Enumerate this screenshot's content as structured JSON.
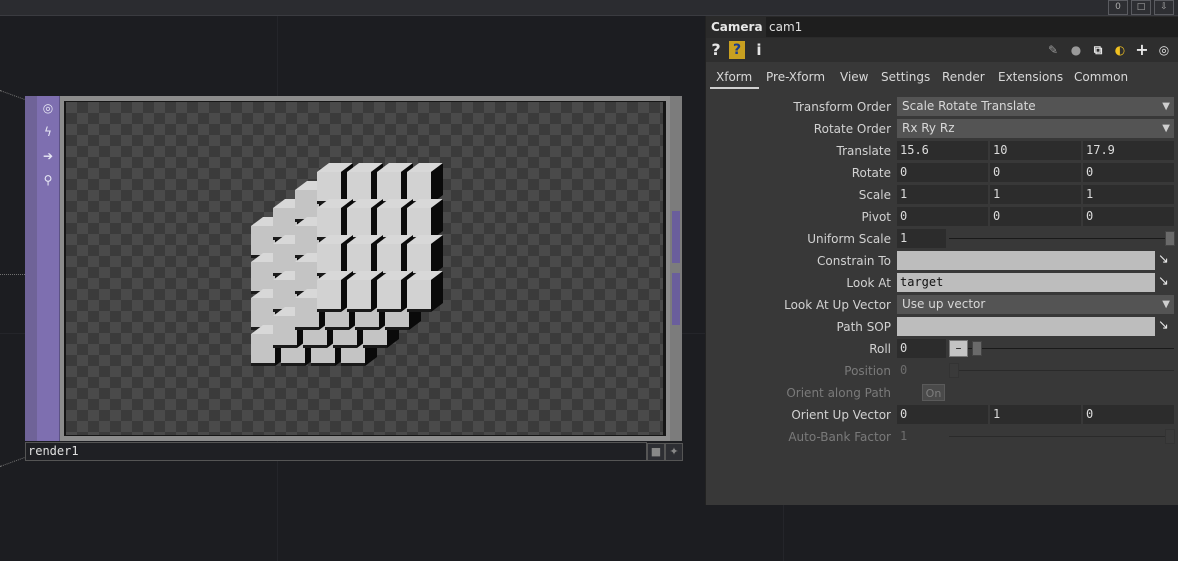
{
  "topbar": {
    "btn1": "0",
    "btn2": "□",
    "btn3": "⇩"
  },
  "node": {
    "label": "render1",
    "tools": [
      "target-icon",
      "pulse-icon",
      "arrow-right-icon",
      "lock-icon"
    ]
  },
  "panel": {
    "op_type": "Camera",
    "op_name": "cam1",
    "help": "?",
    "help_python": "?",
    "info": "i",
    "tabs": [
      "Xform",
      "Pre-Xform",
      "View",
      "Settings",
      "Render",
      "Extensions",
      "Common"
    ],
    "active_tab": "Xform",
    "params": {
      "transform_order": {
        "label": "Transform Order",
        "value": "Scale Rotate Translate"
      },
      "rotate_order": {
        "label": "Rotate Order",
        "value": "Rx Ry Rz"
      },
      "translate": {
        "label": "Translate",
        "x": "15.6",
        "y": "10",
        "z": "17.9"
      },
      "rotate": {
        "label": "Rotate",
        "x": "0",
        "y": "0",
        "z": "0"
      },
      "scale": {
        "label": "Scale",
        "x": "1",
        "y": "1",
        "z": "1"
      },
      "pivot": {
        "label": "Pivot",
        "x": "0",
        "y": "0",
        "z": "0"
      },
      "uniform_scale": {
        "label": "Uniform Scale",
        "value": "1"
      },
      "constrain_to": {
        "label": "Constrain To",
        "value": ""
      },
      "look_at": {
        "label": "Look At",
        "value": "target"
      },
      "look_at_up": {
        "label": "Look At Up Vector",
        "value": "Use up vector"
      },
      "path_sop": {
        "label": "Path SOP",
        "value": ""
      },
      "roll": {
        "label": "Roll",
        "value": "0"
      },
      "position": {
        "label": "Position",
        "value": "0"
      },
      "orient_along_path": {
        "label": "Orient along Path",
        "value": "On"
      },
      "orient_up_vector": {
        "label": "Orient Up Vector",
        "x": "0",
        "y": "1",
        "z": "0"
      },
      "auto_bank": {
        "label": "Auto-Bank Factor",
        "value": "1"
      }
    }
  },
  "colors": {
    "node_purple": "#7e6fb0",
    "panel_bg": "#383838",
    "accent_python": "#3b7dd8"
  }
}
